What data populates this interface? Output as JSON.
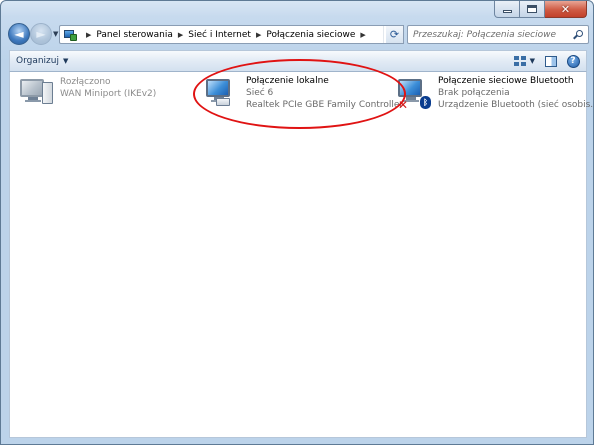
{
  "window": {
    "caption_buttons": [
      "minimize",
      "maximize",
      "close"
    ]
  },
  "navigation": {
    "back_icon": "arrow-left-icon",
    "forward_icon": "arrow-right-icon"
  },
  "address_bar": {
    "breadcrumbs": [
      "Panel sterowania",
      "Sieć i Internet",
      "Połączenia sieciowe"
    ]
  },
  "search": {
    "placeholder": "Przeszukaj: Połączenia sieciowe"
  },
  "toolbar": {
    "organize_label": "Organizuj"
  },
  "connections": [
    {
      "name": "",
      "status": "Rozłączono",
      "device": "WAN Miniport (IKEv2)",
      "icon": "network-adapter-icon",
      "state": "disconnected"
    },
    {
      "name": "Połączenie lokalne",
      "status": "Sieć  6",
      "device": "Realtek PCIe GBE Family Controller",
      "icon": "network-adapter-icon",
      "state": "connected",
      "highlighted": true
    },
    {
      "name": "Połączenie sieciowe Bluetooth",
      "status": "Brak połączenia",
      "device": "Urządzenie Bluetooth (sieć osobis...",
      "icon": "bluetooth-adapter-icon",
      "state": "not-connected"
    }
  ],
  "colors": {
    "highlight": "#e01313",
    "window_frame": "#bcd3ea",
    "close_button": "#cf5b44"
  }
}
